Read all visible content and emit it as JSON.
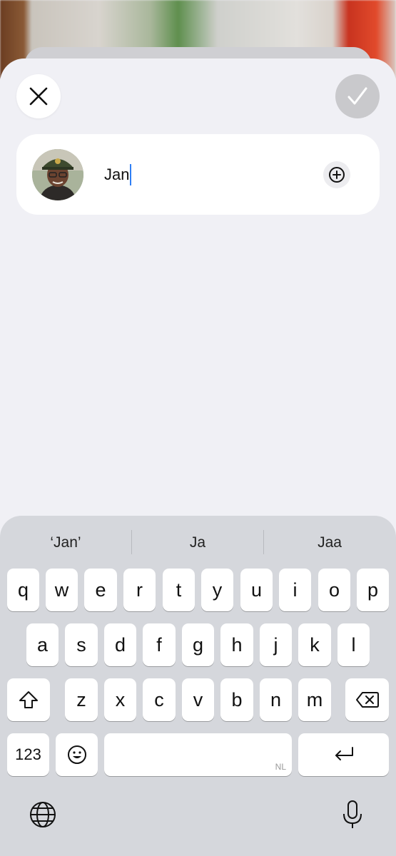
{
  "header": {
    "close_icon": "close-icon",
    "done_icon": "checkmark-icon"
  },
  "contact": {
    "name_value": "Jan",
    "add_icon": "plus-circle-icon"
  },
  "keyboard": {
    "suggestions": [
      "‘Jan’",
      "Ja",
      "Jaa"
    ],
    "row1": [
      "q",
      "w",
      "e",
      "r",
      "t",
      "y",
      "u",
      "i",
      "o",
      "p"
    ],
    "row2": [
      "a",
      "s",
      "d",
      "f",
      "g",
      "h",
      "j",
      "k",
      "l"
    ],
    "row3": [
      "z",
      "x",
      "c",
      "v",
      "b",
      "n",
      "m"
    ],
    "numbers_label": "123",
    "space_language": "NL",
    "colors": {
      "caret": "#2f7ff5",
      "key_bg": "#ffffff",
      "keyboard_bg": "#d5d7dc"
    }
  }
}
